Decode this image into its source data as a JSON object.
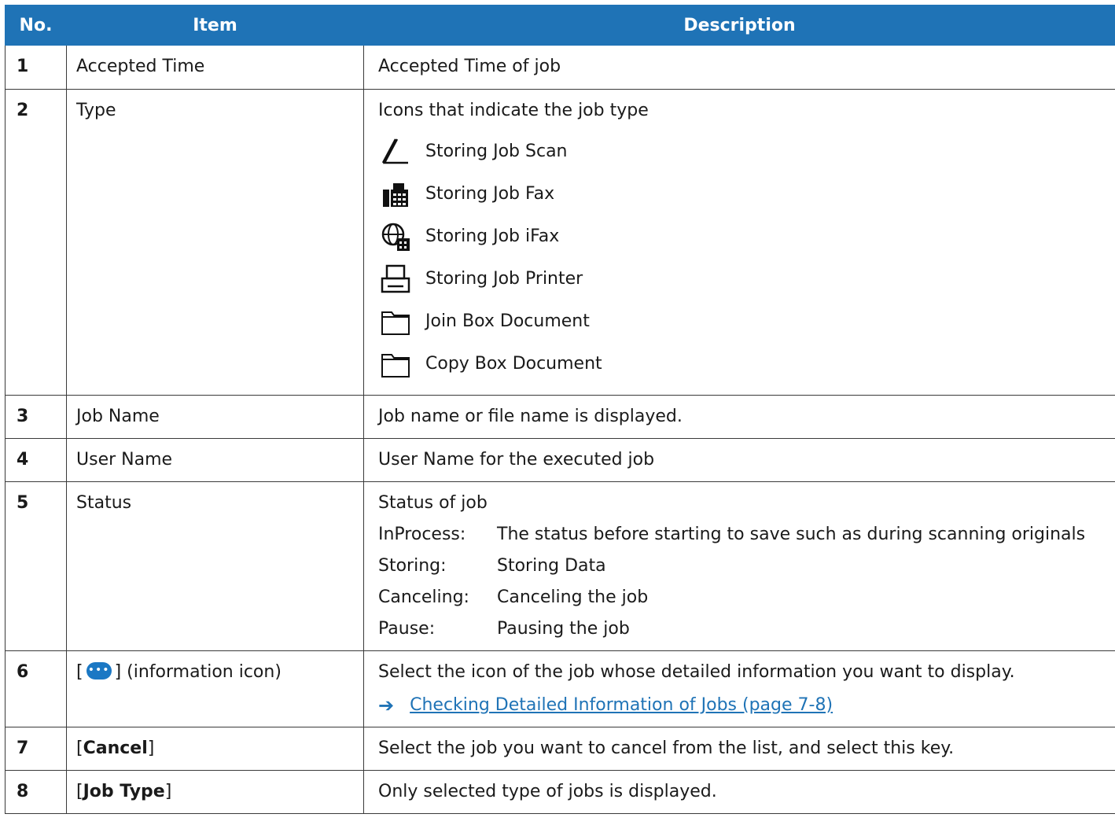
{
  "headers": {
    "no": "No.",
    "item": "Item",
    "description": "Description"
  },
  "rows": [
    {
      "no": "1",
      "item": "Accepted Time",
      "description": "Accepted Time of job"
    },
    {
      "no": "2",
      "item": "Type",
      "description": "Icons that indicate the job type",
      "types": [
        "Storing Job Scan",
        "Storing Job Fax",
        "Storing Job iFax",
        "Storing Job Printer",
        "Join Box Document",
        "Copy Box Document"
      ]
    },
    {
      "no": "3",
      "item": "Job Name",
      "description": "Job name or file name is displayed."
    },
    {
      "no": "4",
      "item": "User Name",
      "description": "User Name for the executed job"
    },
    {
      "no": "5",
      "item": "Status",
      "description": "Status of job",
      "statuses": [
        {
          "key": "InProcess:",
          "value": "The status before starting to save such as during scanning originals"
        },
        {
          "key": "Storing:",
          "value": "Storing Data"
        },
        {
          "key": "Canceling:",
          "value": "Canceling the job"
        },
        {
          "key": "Pause:",
          "value": "Pausing the job"
        }
      ]
    },
    {
      "no": "6",
      "item_prefix": "[",
      "item_suffix": "] (information icon)",
      "description": "Select the icon of the job whose detailed information you want to display.",
      "link": "Checking Detailed Information of Jobs (page 7-8)"
    },
    {
      "no": "7",
      "item_prefix": "[",
      "item_bold": "Cancel",
      "item_suffix": "]",
      "description": "Select the job you want to cancel from the list, and select this key."
    },
    {
      "no": "8",
      "item_prefix": "[",
      "item_bold": "Job Type",
      "item_suffix": "]",
      "description": "Only selected type of jobs is displayed."
    }
  ]
}
